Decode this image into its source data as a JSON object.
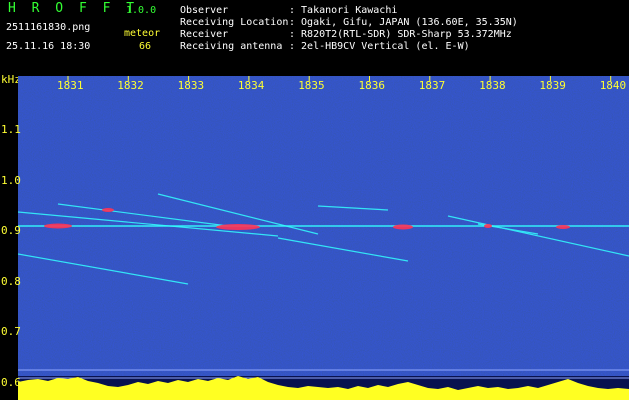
{
  "header": {
    "app_name": "H R O F F T",
    "version": "1.0.0",
    "filename": "2511161830.png",
    "datetime": "25.11.16 18:30",
    "mode_label": "meteor",
    "count": "66",
    "info_labels": [
      "Observer",
      "Receiving Location",
      "Receiver",
      "Receiving antenna"
    ],
    "info_values": [
      ": Takanori Kawachi",
      ": Ogaki, Gifu, JAPAN (136.60E, 35.35N)",
      ": R820T2(RTL-SDR) SDR-Sharp 53.372MHz",
      ": 2el-HB9CV Vertical (el. E-W)"
    ]
  },
  "axes": {
    "y_unit": "kHz",
    "x_ticks": [
      "1831",
      "1832",
      "1833",
      "1834",
      "1835",
      "1836",
      "1837",
      "1838",
      "1839",
      "1840"
    ],
    "y_ticks": [
      "1.1",
      "1.0",
      "0.9",
      "0.8",
      "0.7",
      "0.6"
    ]
  },
  "colors": {
    "background": "#000000",
    "header_green": "#33ff33",
    "header_white": "#ffffff",
    "axis_yellow": "#ffff33",
    "noise_blue": "#0b1a8c",
    "signal_cyan": "#33ffff",
    "signal_hot": "#ff3355"
  }
}
